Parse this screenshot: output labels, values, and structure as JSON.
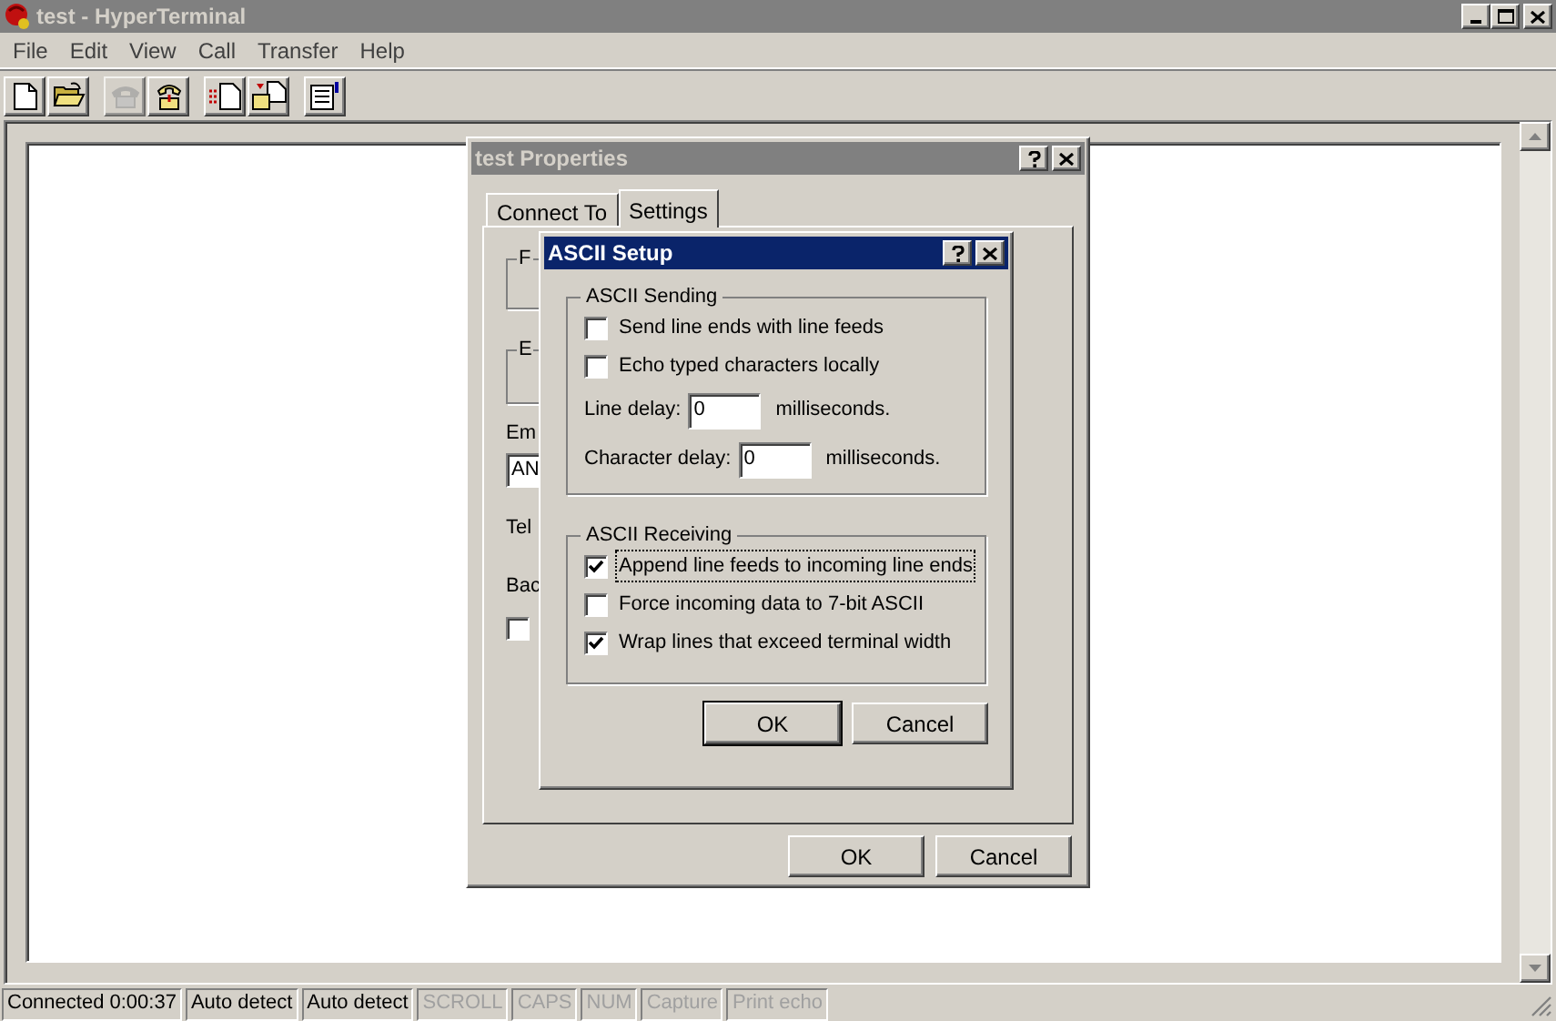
{
  "window": {
    "title": "test - HyperTerminal",
    "active": false
  },
  "menu": [
    "File",
    "Edit",
    "View",
    "Call",
    "Transfer",
    "Help"
  ],
  "toolbar": [
    {
      "kind": "new",
      "disabled": false
    },
    {
      "kind": "open",
      "disabled": false
    },
    {
      "kind": "sep"
    },
    {
      "kind": "phone",
      "disabled": true
    },
    {
      "kind": "dial",
      "disabled": false
    },
    {
      "kind": "sep"
    },
    {
      "kind": "send",
      "disabled": false
    },
    {
      "kind": "receive",
      "disabled": false
    },
    {
      "kind": "sep"
    },
    {
      "kind": "properties",
      "disabled": false
    }
  ],
  "properties_dialog": {
    "title": "test Properties",
    "active": false,
    "tabs": [
      {
        "label": "Connect To",
        "selected": false
      },
      {
        "label": "Settings",
        "selected": true
      }
    ],
    "group_1": "F",
    "group_2": "E",
    "emulation_label": "Em",
    "emulation_value": "AN",
    "telnet_label": "Tel",
    "backscroll_label": "Bac",
    "checkbox": {
      "checked": false
    },
    "buttons": [
      "OK",
      "Cancel"
    ]
  },
  "ascii_setup": {
    "title": "ASCII Setup",
    "active": true,
    "sending": {
      "title": "ASCII Sending",
      "options": [
        {
          "label": "Send line ends with line feeds",
          "checked": false,
          "focused": false
        },
        {
          "label": "Echo typed characters locally",
          "checked": false,
          "focused": false
        }
      ],
      "delays": [
        {
          "label": "Line delay:",
          "value": "0",
          "unit": "milliseconds."
        },
        {
          "label": "Character delay:",
          "value": "0",
          "unit": "milliseconds."
        }
      ]
    },
    "receiving": {
      "title": "ASCII Receiving",
      "options": [
        {
          "label": "Append line feeds to incoming line ends",
          "checked": true,
          "focused": true
        },
        {
          "label": "Force incoming data to 7-bit ASCII",
          "checked": false,
          "focused": false
        },
        {
          "label": "Wrap lines that exceed terminal width",
          "checked": true,
          "focused": false
        }
      ]
    },
    "buttons": [
      {
        "label": "OK",
        "default": true
      },
      {
        "label": "Cancel",
        "default": false
      }
    ]
  },
  "status_bar": [
    {
      "text": "Connected 0:00:37",
      "disabled": false
    },
    {
      "text": "Auto detect",
      "disabled": false
    },
    {
      "text": "Auto detect",
      "disabled": false
    },
    {
      "text": "SCROLL",
      "disabled": true
    },
    {
      "text": "CAPS",
      "disabled": true
    },
    {
      "text": "NUM",
      "disabled": true
    },
    {
      "text": "Capture",
      "disabled": true
    },
    {
      "text": "Print echo",
      "disabled": true
    }
  ]
}
